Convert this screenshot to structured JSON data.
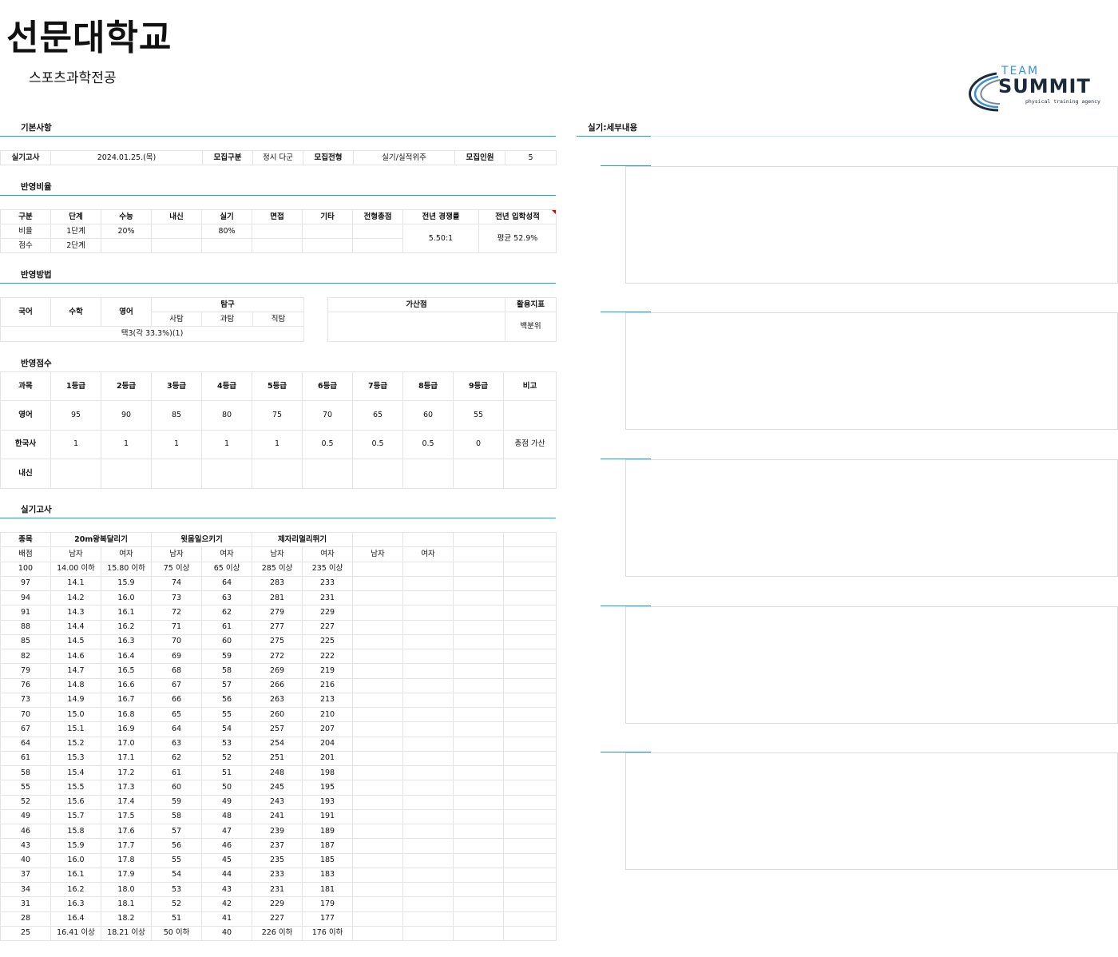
{
  "header": {
    "title": "선문대학교",
    "subtitle": "스포츠과학전공",
    "logo": {
      "top": "TEAM",
      "main": "SUMMIT",
      "tagline": "physical training agency"
    }
  },
  "sections": {
    "basic": "기본사항",
    "ratio": "반영비율",
    "method": "반영방법",
    "score": "반영점수",
    "practical": "실기고사",
    "detail": "실기:세부내용"
  },
  "basic": {
    "exam_label": "실기고사",
    "exam_date": "2024.01.25.(목)",
    "recruit_type_label": "모집구분",
    "recruit_type": "정시 다군",
    "selection_label": "모집전형",
    "selection": "실기/실적위주",
    "quota_label": "모집인원",
    "quota": "5"
  },
  "ratio": {
    "headers": [
      "구분",
      "단계",
      "수능",
      "내신",
      "실기",
      "면접",
      "기타",
      "전형총점",
      "전년 경쟁률",
      "전년 입학성적"
    ],
    "row1": [
      "비율",
      "1단계",
      "20%",
      "",
      "80%",
      "",
      "",
      ""
    ],
    "row2": [
      "점수",
      "2단계",
      "",
      "",
      "",
      "",
      "",
      ""
    ],
    "competition": "5.50:1",
    "admission": "평균 52.9%"
  },
  "method": {
    "korean": "국어",
    "math": "수학",
    "english": "영어",
    "inquiry": "탐구",
    "social": "사탐",
    "science": "과탐",
    "vocational": "직탐",
    "selection_note": "택3(각 33.3%)(1)",
    "bonus_label": "가산점",
    "index_label": "활용지표",
    "index_value": "백분위"
  },
  "score": {
    "headers": [
      "과목",
      "1등급",
      "2등급",
      "3등급",
      "4등급",
      "5등급",
      "6등급",
      "7등급",
      "8등급",
      "9등급",
      "비고"
    ],
    "rows": [
      [
        "영어",
        "95",
        "90",
        "85",
        "80",
        "75",
        "70",
        "65",
        "60",
        "55",
        ""
      ],
      [
        "한국사",
        "1",
        "1",
        "1",
        "1",
        "1",
        "0.5",
        "0.5",
        "0.5",
        "0",
        "총점 가산"
      ],
      [
        "내신",
        "",
        "",
        "",
        "",
        "",
        "",
        "",
        "",
        "",
        ""
      ]
    ]
  },
  "practical": {
    "event_label": "종목",
    "points_label": "배점",
    "events": [
      "20m왕복달리기",
      "윗몸일으키기",
      "제자리멀리뛰기"
    ],
    "gender": [
      "남자",
      "여자",
      "남자",
      "여자",
      "남자",
      "여자",
      "남자",
      "여자"
    ],
    "rows": [
      [
        "100",
        "14.00 이하",
        "15.80 이하",
        "75 이상",
        "65 이상",
        "285 이상",
        "235 이상"
      ],
      [
        "97",
        "14.1",
        "15.9",
        "74",
        "64",
        "283",
        "233"
      ],
      [
        "94",
        "14.2",
        "16.0",
        "73",
        "63",
        "281",
        "231"
      ],
      [
        "91",
        "14.3",
        "16.1",
        "72",
        "62",
        "279",
        "229"
      ],
      [
        "88",
        "14.4",
        "16.2",
        "71",
        "61",
        "277",
        "227"
      ],
      [
        "85",
        "14.5",
        "16.3",
        "70",
        "60",
        "275",
        "225"
      ],
      [
        "82",
        "14.6",
        "16.4",
        "69",
        "59",
        "272",
        "222"
      ],
      [
        "79",
        "14.7",
        "16.5",
        "68",
        "58",
        "269",
        "219"
      ],
      [
        "76",
        "14.8",
        "16.6",
        "67",
        "57",
        "266",
        "216"
      ],
      [
        "73",
        "14.9",
        "16.7",
        "66",
        "56",
        "263",
        "213"
      ],
      [
        "70",
        "15.0",
        "16.8",
        "65",
        "55",
        "260",
        "210"
      ],
      [
        "67",
        "15.1",
        "16.9",
        "64",
        "54",
        "257",
        "207"
      ],
      [
        "64",
        "15.2",
        "17.0",
        "63",
        "53",
        "254",
        "204"
      ],
      [
        "61",
        "15.3",
        "17.1",
        "62",
        "52",
        "251",
        "201"
      ],
      [
        "58",
        "15.4",
        "17.2",
        "61",
        "51",
        "248",
        "198"
      ],
      [
        "55",
        "15.5",
        "17.3",
        "60",
        "50",
        "245",
        "195"
      ],
      [
        "52",
        "15.6",
        "17.4",
        "59",
        "49",
        "243",
        "193"
      ],
      [
        "49",
        "15.7",
        "17.5",
        "58",
        "48",
        "241",
        "191"
      ],
      [
        "46",
        "15.8",
        "17.6",
        "57",
        "47",
        "239",
        "189"
      ],
      [
        "43",
        "15.9",
        "17.7",
        "56",
        "46",
        "237",
        "187"
      ],
      [
        "40",
        "16.0",
        "17.8",
        "55",
        "45",
        "235",
        "185"
      ],
      [
        "37",
        "16.1",
        "17.9",
        "54",
        "44",
        "233",
        "183"
      ],
      [
        "34",
        "16.2",
        "18.0",
        "53",
        "43",
        "231",
        "181"
      ],
      [
        "31",
        "16.3",
        "18.1",
        "52",
        "42",
        "229",
        "179"
      ],
      [
        "28",
        "16.4",
        "18.2",
        "51",
        "41",
        "227",
        "177"
      ],
      [
        "25",
        "16.41 이상",
        "18.21 이상",
        "50 이하",
        "40",
        "226 이하",
        "176 이하"
      ]
    ]
  },
  "colors": {
    "accent": "#1aa0d8",
    "logo_blue": "#3a8fd6",
    "logo_dark": "#1c2a3a"
  }
}
